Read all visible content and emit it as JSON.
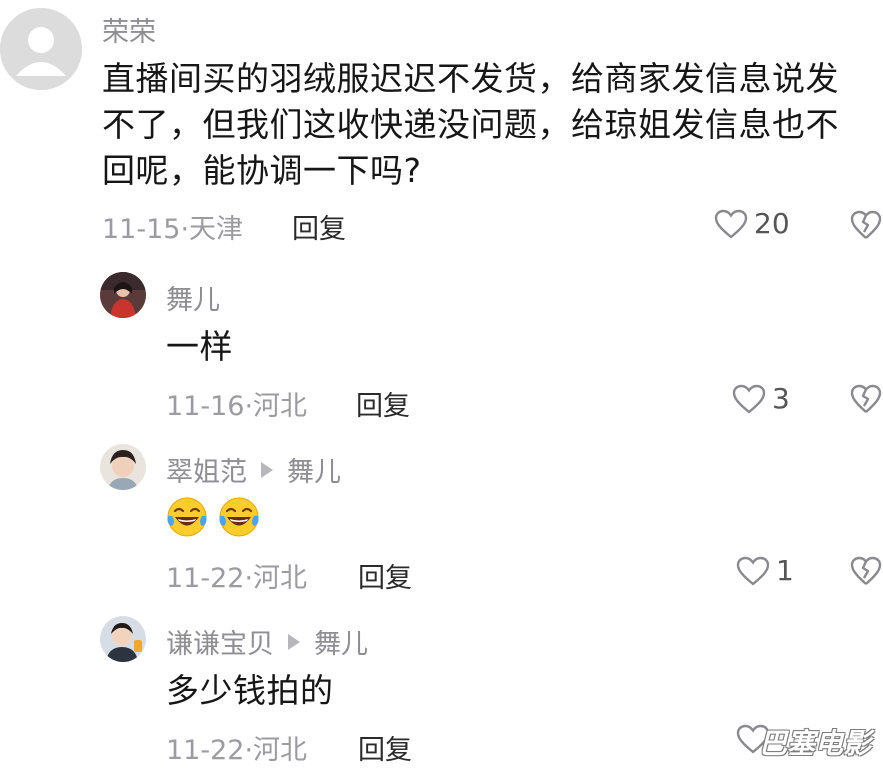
{
  "comments": [
    {
      "author": "荣荣",
      "lines": [
        "直播间买的羽绒服迟迟不发货，给商家发信息说发",
        "不了，但我们这收快递没问题，给琼姐发信息也不",
        "回呢，能协调一下吗?"
      ],
      "meta": "11-15·天津",
      "reply_label": "回复",
      "likes": "20"
    }
  ],
  "replies": [
    {
      "author": "舞儿",
      "reply_to": "",
      "text": "一样",
      "meta": "11-16·河北",
      "reply_label": "回复",
      "likes": "3"
    },
    {
      "author": "翠姐范",
      "reply_to": "舞儿",
      "text": "",
      "emojis": [
        "laughing-tears-emoji",
        "laughing-tears-emoji"
      ],
      "meta": "11-22·河北",
      "reply_label": "回复",
      "likes": "1"
    },
    {
      "author": "谦谦宝贝",
      "reply_to": "舞儿",
      "text": "多少钱拍的",
      "meta": "11-22·河北",
      "reply_label": "回复",
      "likes": ""
    }
  ],
  "watermark": "巴塞电影",
  "colors": {
    "meta": "#9b9ba0",
    "text": "#161616",
    "icon": "#8a8a8e"
  }
}
